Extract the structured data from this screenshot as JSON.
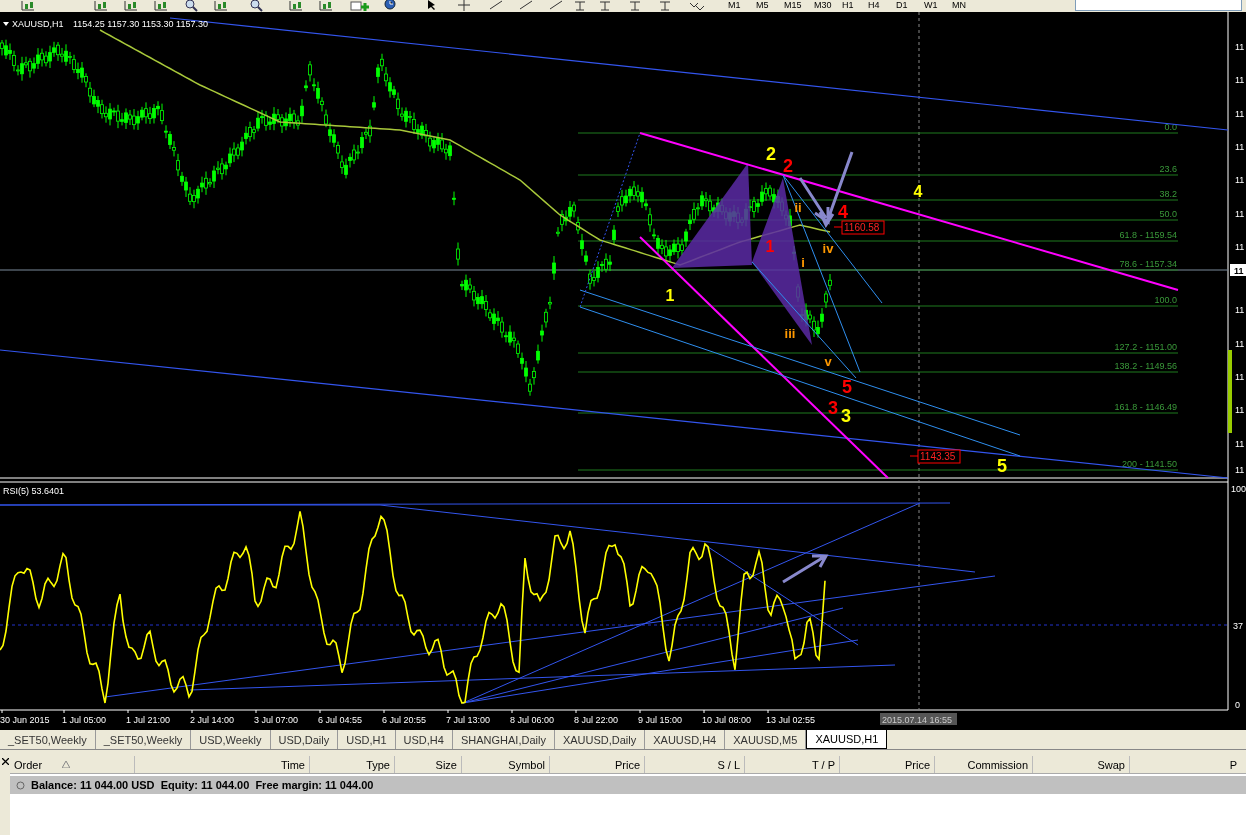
{
  "toolbar": {
    "timeframes": [
      "M1",
      "M5",
      "M15",
      "M30",
      "H1",
      "H4",
      "D1",
      "W1",
      "MN"
    ]
  },
  "chart": {
    "header": {
      "symbol": "XAUUSD,H1",
      "ohlc": "1154.25 1157.30 1153.30 1157.30"
    },
    "price_axis": [
      "11",
      "11",
      "11",
      "11",
      "11",
      "11",
      "11",
      "11",
      "11",
      "11",
      "11",
      "11",
      "11"
    ],
    "current_price": "11",
    "fib_levels": [
      "0.0",
      "23.6",
      "38.2",
      "50.0",
      "61.8 - 1159.54",
      "78.6 - 1157.34",
      "100.0",
      "127.2 - 1151.00",
      "138.2 - 1149.56",
      "161.8 - 1146.49",
      "200 - 1141.50"
    ],
    "wave_labels": [
      {
        "text": "2",
        "color": "#ffff00"
      },
      {
        "text": "2",
        "color": "#ff0000"
      },
      {
        "text": "4",
        "color": "#ff0000"
      },
      {
        "text": "4",
        "color": "#ffff00"
      },
      {
        "text": "1",
        "color": "#ff0000"
      },
      {
        "text": "1",
        "color": "#ffff00"
      },
      {
        "text": "ii",
        "color": "#ff9900"
      },
      {
        "text": "i",
        "color": "#ff9900"
      },
      {
        "text": "iv",
        "color": "#ff9900"
      },
      {
        "text": "iii",
        "color": "#ff9900"
      },
      {
        "text": "v",
        "color": "#ff9900"
      },
      {
        "text": "3",
        "color": "#ff0000"
      },
      {
        "text": "5",
        "color": "#ff0000"
      },
      {
        "text": "3",
        "color": "#ffff00"
      },
      {
        "text": "5",
        "color": "#ffff00"
      }
    ],
    "price_tags": [
      "1160.58",
      "1143.35"
    ],
    "rsi": {
      "label": "RSI(5) 53.6401",
      "axis": [
        "100",
        "37",
        "0"
      ]
    },
    "time_axis": [
      "30 Jun 2015",
      "1 Jul 05:00",
      "1 Jul 21:00",
      "2 Jul 14:00",
      "3 Jul 07:00",
      "6 Jul 04:55",
      "6 Jul 20:55",
      "7 Jul 13:00",
      "8 Jul 06:00",
      "8 Jul 22:00",
      "9 Jul 15:00",
      "10 Jul 08:00",
      "13 Jul 02:55"
    ],
    "cursor_time": "2015.07.14 16:55"
  },
  "tabs": [
    {
      "label": "_SET50,Weekly",
      "selected": false
    },
    {
      "label": "_SET50,Weekly",
      "selected": false
    },
    {
      "label": "USD,Weekly",
      "selected": false
    },
    {
      "label": "USD,Daily",
      "selected": false
    },
    {
      "label": "USD,H1",
      "selected": false
    },
    {
      "label": "USD,H4",
      "selected": false
    },
    {
      "label": "SHANGHAI,Daily",
      "selected": false
    },
    {
      "label": "XAUUSD,Daily",
      "selected": false
    },
    {
      "label": "XAUUSD,H4",
      "selected": false
    },
    {
      "label": "XAUUSD,M5",
      "selected": false
    },
    {
      "label": "XAUUSD,H1",
      "selected": true
    }
  ],
  "terminal": {
    "columns": [
      "Order",
      "Time",
      "Type",
      "Size",
      "Symbol",
      "Price",
      "S / L",
      "T / P",
      "Price",
      "Commission",
      "Swap",
      "P"
    ],
    "balance_row": "Balance: 11 044.00 USD  Equity: 11 044.00  Free margin: 11 044.00"
  }
}
